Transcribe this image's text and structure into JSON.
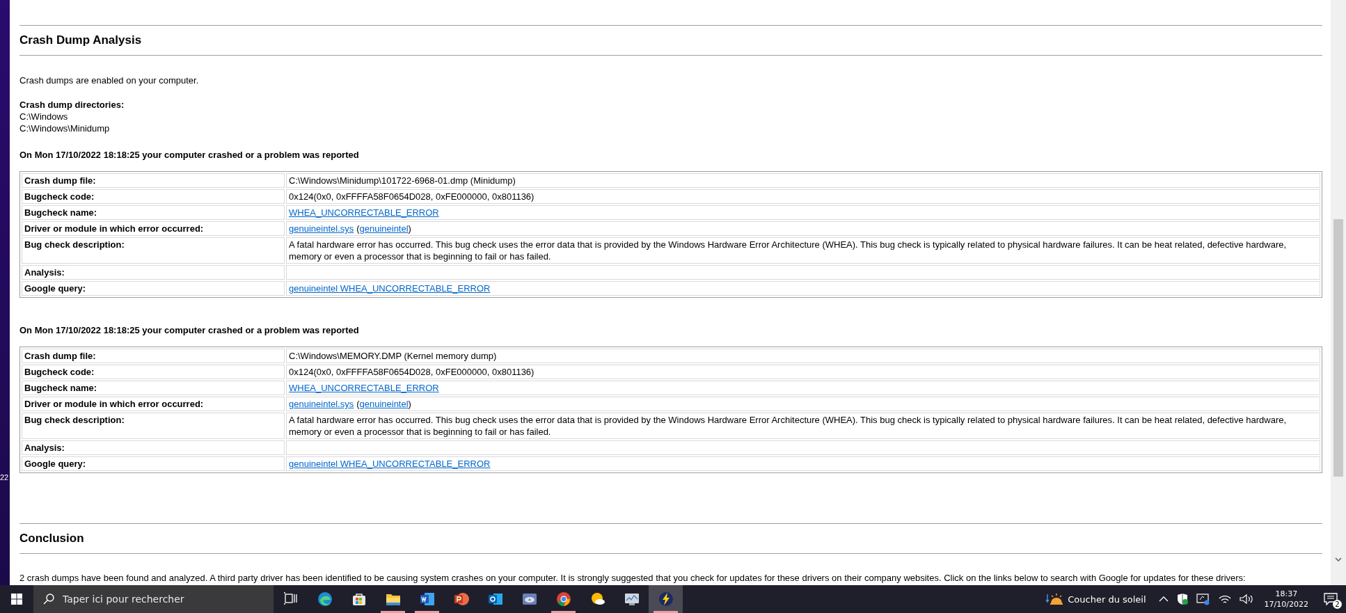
{
  "desktop_edge": {
    "text": "22"
  },
  "section": {
    "title": "Crash Dump Analysis"
  },
  "intro": "Crash dumps are enabled on your computer.",
  "directories": {
    "label": "Crash dump directories:",
    "paths": [
      "C:\\Windows",
      "C:\\Windows\\Minidump"
    ]
  },
  "crashes": [
    {
      "heading": "On Mon 17/10/2022 18:18:25 your computer crashed or a problem was reported",
      "rows": [
        {
          "label": "Crash dump file:",
          "value": [
            {
              "kind": "text",
              "text": "C:\\Windows\\Minidump\\101722-6968-01.dmp (Minidump)"
            }
          ]
        },
        {
          "label": "Bugcheck code:",
          "value": [
            {
              "kind": "text",
              "text": "0x124(0x0, 0xFFFFA58F0654D028, 0xFE000000, 0x801136)"
            }
          ]
        },
        {
          "label": "Bugcheck name:",
          "value": [
            {
              "kind": "link",
              "text": "WHEA_UNCORRECTABLE_ERROR"
            }
          ]
        },
        {
          "label": "Driver or module in which error occurred:",
          "value": [
            {
              "kind": "link",
              "text": "genuineintel.sys"
            },
            {
              "kind": "text",
              "text": "(",
              "space_before": true
            },
            {
              "kind": "link",
              "text": "genuineintel"
            },
            {
              "kind": "text",
              "text": ")"
            }
          ]
        },
        {
          "label": "Bug check description:",
          "value": [
            {
              "kind": "text",
              "text": "A fatal hardware error has occurred. This bug check uses the error data that is provided by the Windows Hardware Error Architecture (WHEA). This bug check is typically related to physical hardware failures. It can be heat related, defective hardware, memory or even a processor that is beginning to fail or has failed."
            }
          ]
        },
        {
          "label": "Analysis:",
          "value": []
        },
        {
          "label": "Google query:",
          "value": [
            {
              "kind": "link",
              "text": "genuineintel WHEA_UNCORRECTABLE_ERROR"
            }
          ]
        }
      ]
    },
    {
      "heading": "On Mon 17/10/2022 18:18:25 your computer crashed or a problem was reported",
      "rows": [
        {
          "label": "Crash dump file:",
          "value": [
            {
              "kind": "text",
              "text": "C:\\Windows\\MEMORY.DMP (Kernel memory dump)"
            }
          ]
        },
        {
          "label": "Bugcheck code:",
          "value": [
            {
              "kind": "text",
              "text": "0x124(0x0, 0xFFFFA58F0654D028, 0xFE000000, 0x801136)"
            }
          ]
        },
        {
          "label": "Bugcheck name:",
          "value": [
            {
              "kind": "link",
              "text": "WHEA_UNCORRECTABLE_ERROR"
            }
          ]
        },
        {
          "label": "Driver or module in which error occurred:",
          "value": [
            {
              "kind": "link",
              "text": "genuineintel.sys"
            },
            {
              "kind": "text",
              "text": "(",
              "space_before": true
            },
            {
              "kind": "link",
              "text": "genuineintel"
            },
            {
              "kind": "text",
              "text": ")"
            }
          ]
        },
        {
          "label": "Bug check description:",
          "value": [
            {
              "kind": "text",
              "text": "A fatal hardware error has occurred. This bug check uses the error data that is provided by the Windows Hardware Error Architecture (WHEA). This bug check is typically related to physical hardware failures. It can be heat related, defective hardware, memory or even a processor that is beginning to fail or has failed."
            }
          ]
        },
        {
          "label": "Analysis:",
          "value": []
        },
        {
          "label": "Google query:",
          "value": [
            {
              "kind": "link",
              "text": "genuineintel WHEA_UNCORRECTABLE_ERROR"
            }
          ]
        }
      ]
    }
  ],
  "conclusion": {
    "title": "Conclusion",
    "text": "2 crash dumps have been found and analyzed. A third party driver has been identified to be causing system crashes on your computer. It is strongly suggested that you check for updates for these drivers on their company websites. Click on the links below to search with Google for updates for these drivers:"
  },
  "taskbar": {
    "search": {
      "placeholder": "Taper ici pour rechercher"
    },
    "apps": [
      {
        "kind": "taskview",
        "running": false,
        "selected": false
      },
      {
        "kind": "edge",
        "running": false,
        "selected": false
      },
      {
        "kind": "store",
        "running": false,
        "selected": false
      },
      {
        "kind": "folder",
        "running": true,
        "selected": false
      },
      {
        "kind": "word",
        "running": true,
        "selected": false
      },
      {
        "kind": "powerpoint",
        "running": false,
        "selected": false
      },
      {
        "kind": "outlook",
        "running": false,
        "selected": false
      },
      {
        "kind": "disc",
        "running": false,
        "selected": false
      },
      {
        "kind": "chrome",
        "running": true,
        "selected": false
      },
      {
        "kind": "weather",
        "running": false,
        "selected": false
      },
      {
        "kind": "monitor",
        "running": false,
        "selected": false
      },
      {
        "kind": "bolt",
        "running": true,
        "selected": true
      }
    ],
    "weather": "Coucher du soleil",
    "time": "18:37",
    "date": "17/10/2022",
    "notifications": "2"
  }
}
